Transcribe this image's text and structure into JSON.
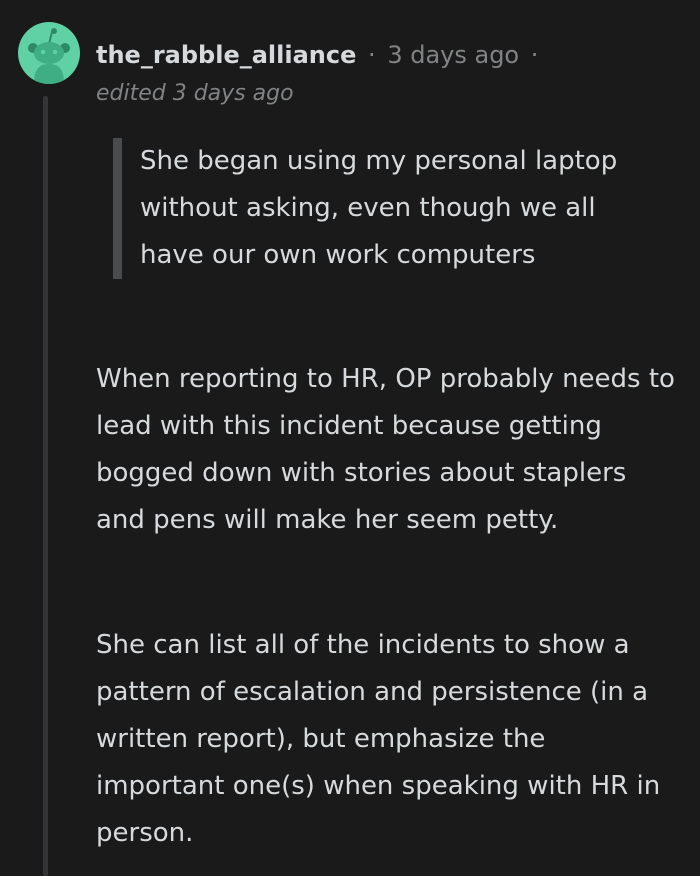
{
  "comment": {
    "username": "the_rabble_alliance",
    "separator": "·",
    "timestamp": "3 days ago",
    "edited": "edited 3 days ago",
    "quote": "She began using my personal laptop without asking, even though we all have our own work computers",
    "paragraphs": [
      "When reporting to HR, OP probably needs to lead with this incident because getting bogged down with stories about staplers and pens will make her seem petty.",
      "She can list all of the incidents to show a pattern of escalation and persistence (in a written report), but emphasize the important one(s) when speaking with HR in person."
    ]
  },
  "colors": {
    "background": "#1a1a1b",
    "text": "#d7dadc",
    "muted": "#818384",
    "avatar_bg": "#5fd1a4",
    "quote_bar": "#4a4b4d",
    "thread_line": "#343536"
  },
  "icons": {
    "avatar": "snoo-avatar-icon"
  }
}
